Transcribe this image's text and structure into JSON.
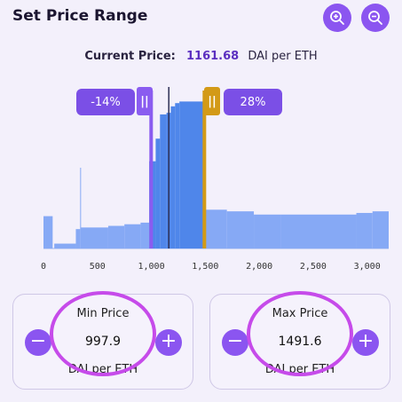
{
  "header": {
    "title": "Set Price Range"
  },
  "toolbar": {
    "zoom_in_icon": "zoom-in-icon",
    "zoom_out_icon": "zoom-out-icon"
  },
  "current_price": {
    "label": "Current Price:",
    "value": "1161.68",
    "unit": "DAI per ETH"
  },
  "range": {
    "min_pct": "-14%",
    "max_pct": "28%",
    "min_handle": "||",
    "max_handle": "||"
  },
  "colors": {
    "accent": "#8b55f0",
    "bars": "#86a9f5",
    "bars_selected": "#4f86ea",
    "min_handle": "#8a5cf0",
    "max_handle": "#d39a17"
  },
  "chart_data": {
    "type": "bar",
    "x_ticks": [
      "0",
      "500",
      "1,000",
      "1,500",
      "2,000",
      "2,500",
      "3,000"
    ],
    "xlim": [
      0,
      3200
    ],
    "current_price": 1161.68,
    "selected_range": [
      997.9,
      1491.6
    ],
    "liquidity": [
      [
        0,
        85,
        20
      ],
      [
        85,
        100,
        0
      ],
      [
        100,
        300,
        3
      ],
      [
        300,
        340,
        12
      ],
      [
        340,
        345,
        50
      ],
      [
        345,
        600,
        13
      ],
      [
        600,
        750,
        14
      ],
      [
        750,
        900,
        15
      ],
      [
        900,
        980,
        16
      ],
      [
        980,
        1040,
        54
      ],
      [
        1040,
        1080,
        68
      ],
      [
        1080,
        1140,
        83
      ],
      [
        1140,
        1180,
        84
      ],
      [
        1180,
        1220,
        88
      ],
      [
        1220,
        1260,
        90
      ],
      [
        1260,
        1500,
        91
      ],
      [
        1500,
        1700,
        24
      ],
      [
        1700,
        1950,
        23
      ],
      [
        1950,
        2200,
        21
      ],
      [
        2200,
        2900,
        21
      ],
      [
        2900,
        3050,
        22
      ],
      [
        3050,
        3200,
        23
      ]
    ]
  },
  "min_card": {
    "title": "Min Price",
    "value": "997.9",
    "unit": "DAI per ETH",
    "minus": "−",
    "plus": "+"
  },
  "max_card": {
    "title": "Max Price",
    "value": "1491.6",
    "unit": "DAI per ETH",
    "minus": "−",
    "plus": "+"
  }
}
